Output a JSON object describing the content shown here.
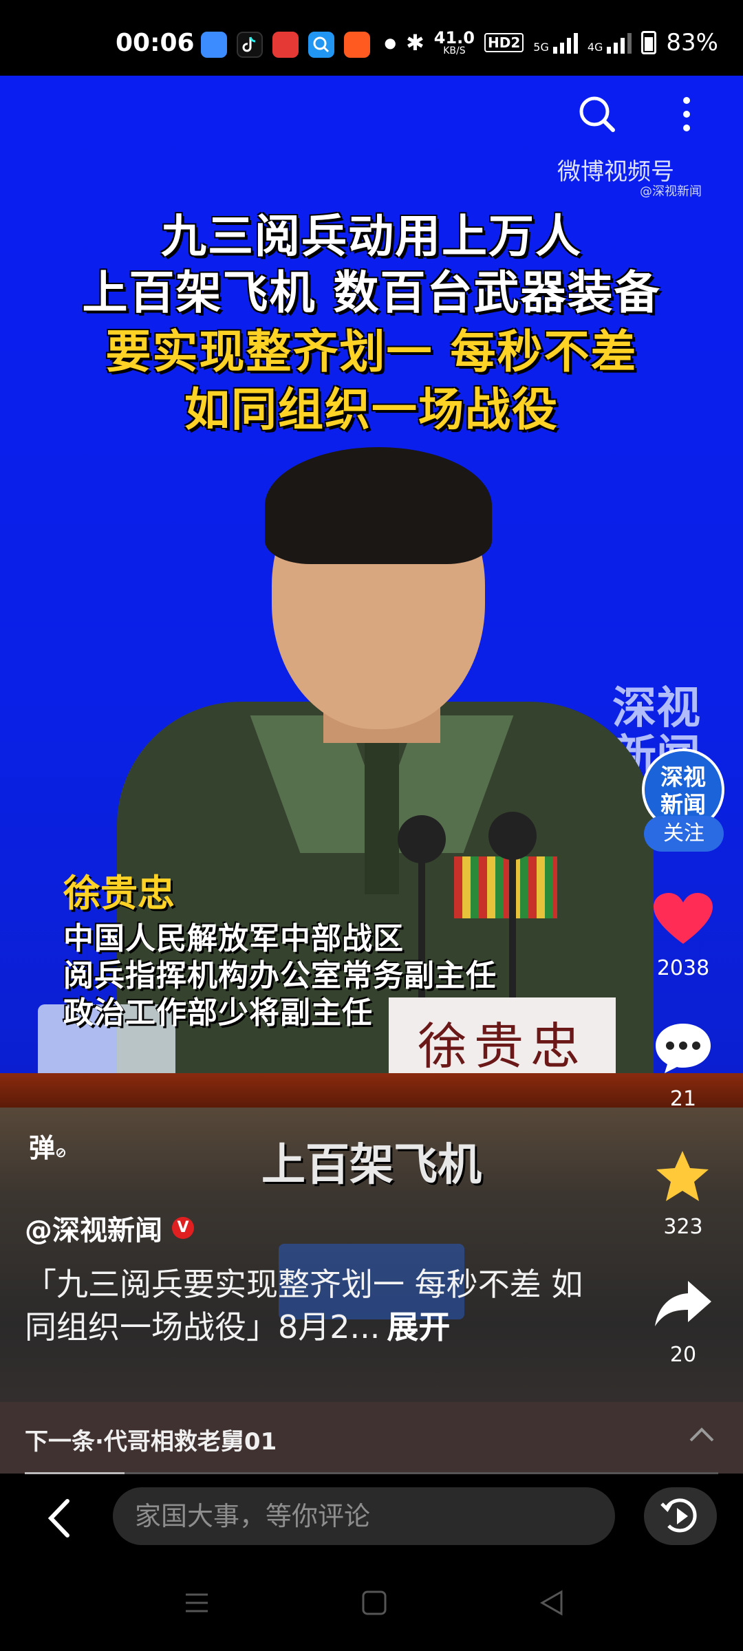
{
  "status_bar": {
    "time": "00:06",
    "net_speed_top": "41.0",
    "net_speed_unit": "KB/S",
    "hd_label": "HD2",
    "sig1_label": "5G",
    "sig2_label": "4G",
    "battery": "83%",
    "app_icons": [
      "blue-app-icon",
      "tiktok-icon",
      "red-app-icon",
      "search-app-icon",
      "orange-app-icon"
    ]
  },
  "video": {
    "title_lines": [
      "九三阅兵动用上万人",
      "上百架飞机 数百台武器装备"
    ],
    "highlight_lines": [
      "要实现整齐划一 每秒不差",
      "如同组织一场战役"
    ],
    "weibo_watermark": "微博视频号",
    "weibo_sub": "@深视新闻",
    "channel_watermark_1": "深视",
    "channel_watermark_2": "新闻",
    "caption_name": "徐贵忠",
    "caption_lines": [
      "中国人民解放军中部战区",
      "阅兵指挥机构办公室常务副主任",
      "政治工作部少将副主任"
    ],
    "nameplate": "徐贵忠",
    "subtitle": "上百架飞机"
  },
  "actions": {
    "avatar_text_1": "深视",
    "avatar_text_2": "新闻",
    "follow_label": "关注",
    "like_count": "2038",
    "comment_count": "21",
    "favorite_count": "323",
    "share_count": "20"
  },
  "post": {
    "danmaku_label": "弹",
    "author": "@深视新闻",
    "verified_mark": "V",
    "description": "「九三阅兵要实现整齐划一 每秒不差 如同组织一场战役」8月2...",
    "expand_label": "展开"
  },
  "next": {
    "label": "下一条·代哥相救老舅01"
  },
  "comment_bar": {
    "placeholder": "家国大事，等你评论"
  },
  "colors": {
    "video_bg": "#0a1ef2",
    "highlight_text": "#ffd226",
    "like": "#ff2c55",
    "favorite": "#ffc93a",
    "follow": "#2a6be4"
  }
}
